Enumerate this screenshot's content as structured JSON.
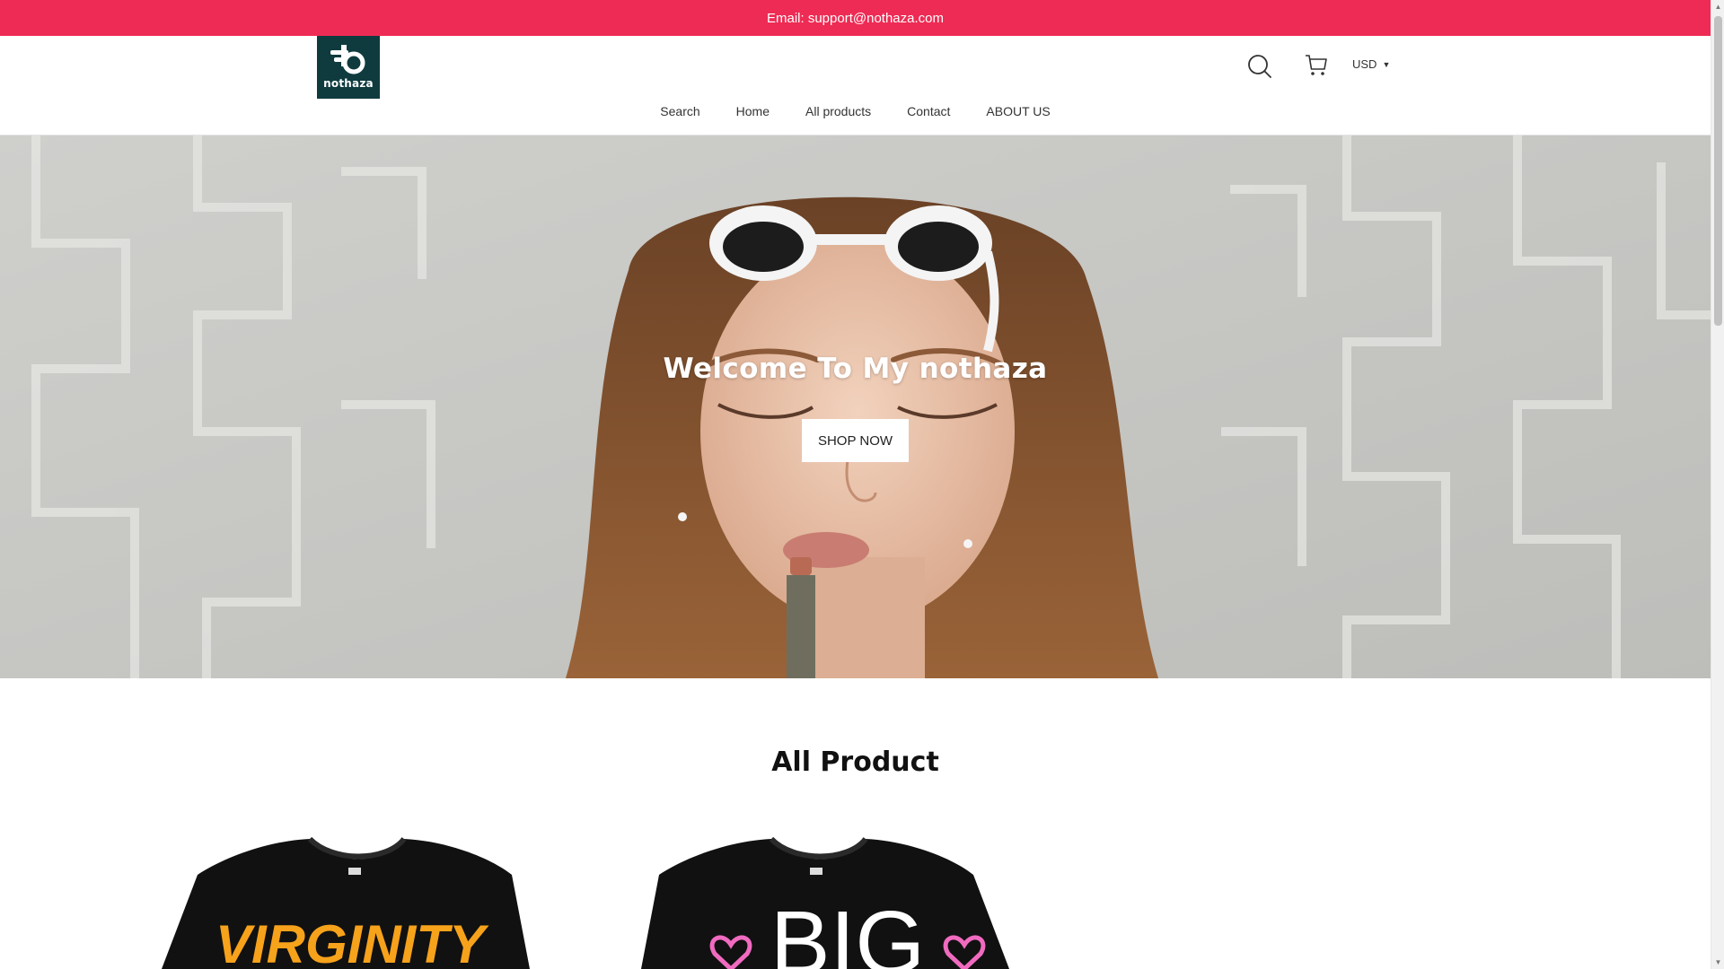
{
  "announcement": {
    "text": "Email: support@nothaza.com"
  },
  "header": {
    "logo_text": "nothaza",
    "currency": "USD",
    "nav": [
      {
        "label": "Search"
      },
      {
        "label": "Home"
      },
      {
        "label": "All products"
      },
      {
        "label": "Contact"
      },
      {
        "label": "ABOUT US"
      }
    ]
  },
  "hero": {
    "title": "Welcome To My nothaza",
    "button_label": "SHOP NOW"
  },
  "section": {
    "title": "All Product"
  },
  "products": [
    {
      "print_text": "VIRGINITY"
    },
    {
      "print_text": "BIG"
    }
  ],
  "colors": {
    "announcement_bg": "#ee2b54",
    "logo_bg": "#0f3b3f"
  },
  "icons": [
    "search-icon",
    "cart-icon",
    "chevron-down-icon"
  ]
}
